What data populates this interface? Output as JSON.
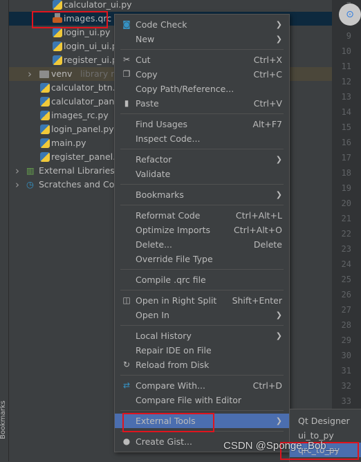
{
  "sidebar_label": "Bookmarks",
  "tree": [
    {
      "label": "calculator_ui.py",
      "icon": "python-file-icon",
      "indent": 3
    },
    {
      "label": "images.qrc",
      "icon": "qrc-file-icon",
      "indent": 3,
      "selected": true
    },
    {
      "label": "login_ui.py",
      "icon": "python-file-icon",
      "indent": 3
    },
    {
      "label": "login_ui_ui.py",
      "icon": "python-file-icon",
      "indent": 3
    },
    {
      "label": "register_ui.py",
      "icon": "python-file-icon",
      "indent": 3
    },
    {
      "label": "venv",
      "suffix": "library root",
      "icon": "folder-icon",
      "indent": 1,
      "arrow": true,
      "excluded": true
    },
    {
      "label": "calculator_btn.py",
      "icon": "python-file-icon",
      "indent": 2
    },
    {
      "label": "calculator_panel.py",
      "icon": "python-file-icon",
      "indent": 2
    },
    {
      "label": "images_rc.py",
      "icon": "python-file-icon",
      "indent": 2
    },
    {
      "label": "login_panel.py",
      "icon": "python-file-icon",
      "indent": 2
    },
    {
      "label": "main.py",
      "icon": "python-file-icon",
      "indent": 2
    },
    {
      "label": "register_panel.py",
      "icon": "python-file-icon",
      "indent": 2
    },
    {
      "label": "External Libraries",
      "icon": "libraries-icon",
      "indent": 0,
      "arrow": true
    },
    {
      "label": "Scratches and Consoles",
      "icon": "scratches-icon",
      "indent": 0,
      "arrow": true
    }
  ],
  "line_numbers": [
    "7",
    "8",
    "9",
    "10",
    "11",
    "12",
    "13",
    "14",
    "15",
    "16",
    "17",
    "18",
    "19",
    "20",
    "21",
    "22",
    "23",
    "24",
    "25",
    "26",
    "27",
    "28",
    "29",
    "30",
    "31",
    "32",
    "33"
  ],
  "menu": [
    {
      "label": "Code Check",
      "icon": "code-check-icon",
      "submenu": true
    },
    {
      "label": "New",
      "submenu": true
    },
    {
      "sep": true
    },
    {
      "label": "Cut",
      "shortcut": "Ctrl+X",
      "icon": "scissors-icon"
    },
    {
      "label": "Copy",
      "shortcut": "Ctrl+C",
      "icon": "copy-icon"
    },
    {
      "label": "Copy Path/Reference..."
    },
    {
      "label": "Paste",
      "shortcut": "Ctrl+V",
      "icon": "clipboard-icon"
    },
    {
      "sep": true
    },
    {
      "label": "Find Usages",
      "shortcut": "Alt+F7"
    },
    {
      "label": "Inspect Code..."
    },
    {
      "sep": true
    },
    {
      "label": "Refactor",
      "submenu": true
    },
    {
      "label": "Validate"
    },
    {
      "sep": true
    },
    {
      "label": "Bookmarks",
      "submenu": true
    },
    {
      "sep": true
    },
    {
      "label": "Reformat Code",
      "shortcut": "Ctrl+Alt+L"
    },
    {
      "label": "Optimize Imports",
      "shortcut": "Ctrl+Alt+O"
    },
    {
      "label": "Delete...",
      "shortcut": "Delete"
    },
    {
      "label": "Override File Type"
    },
    {
      "sep": true
    },
    {
      "label": "Compile .qrc file"
    },
    {
      "sep": true
    },
    {
      "label": "Open in Right Split",
      "shortcut": "Shift+Enter",
      "icon": "split-icon"
    },
    {
      "label": "Open In",
      "submenu": true
    },
    {
      "sep": true
    },
    {
      "label": "Local History",
      "submenu": true
    },
    {
      "label": "Repair IDE on File"
    },
    {
      "label": "Reload from Disk",
      "icon": "reload-icon"
    },
    {
      "sep": true
    },
    {
      "label": "Compare With...",
      "shortcut": "Ctrl+D",
      "icon": "compare-icon"
    },
    {
      "label": "Compare File with Editor"
    },
    {
      "sep": true
    },
    {
      "label": "External Tools",
      "submenu": true,
      "highlighted": true
    },
    {
      "sep": true
    },
    {
      "label": "Create Gist...",
      "icon": "github-icon"
    }
  ],
  "submenu": [
    {
      "label": "Qt Designer"
    },
    {
      "label": "ui_to_py"
    },
    {
      "label": "qrc_to_py",
      "highlighted": true
    }
  ],
  "watermark": "CSDN @Sponge_Bob__",
  "colors": {
    "highlight": "#4b6eaf",
    "selection": "#0d293e",
    "annotation_red": "#e0141e"
  }
}
